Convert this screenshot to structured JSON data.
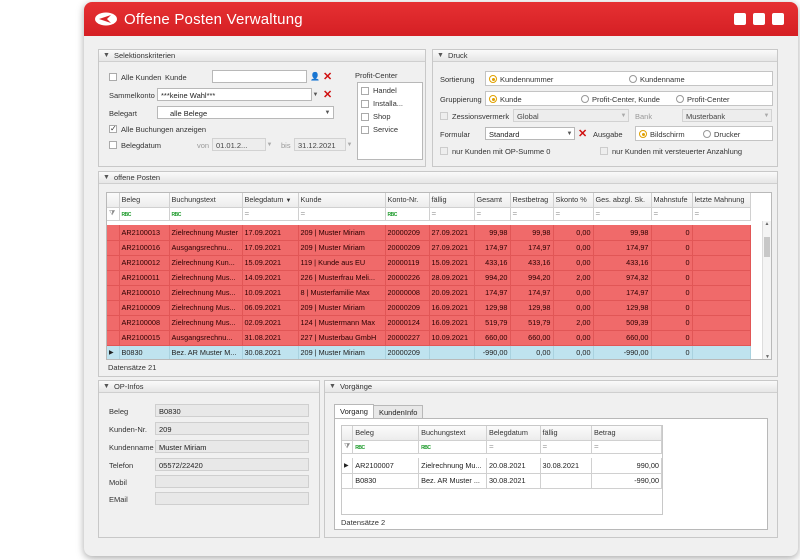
{
  "title": "Offene Posten Verwaltung",
  "selektion": {
    "header": "Selektionskriterien",
    "alle_kunden": "Alle Kunden",
    "kunde_label": "Kunde",
    "kunde_value": "",
    "sammelkonto_label": "Sammelkonto",
    "sammelkonto_value": "***keine Wahl***",
    "belegart_label": "Belegart",
    "belegart_value": "alle Belege",
    "alle_buchungen": "Alle Buchungen anzeigen",
    "belegdatum": "Belegdatum",
    "von": "von",
    "von_value": "01.01.2...",
    "bis": "bis",
    "bis_value": "31.12.2021",
    "profit_center_label": "Profit-Center",
    "profit_centers": [
      "Handel",
      "Installa...",
      "Shop",
      "Service"
    ]
  },
  "druck": {
    "header": "Druck",
    "sortierung": "Sortierung",
    "sort_options": [
      "Kundennummer",
      "Kundenname"
    ],
    "gruppierung": "Gruppierung",
    "group_options": [
      "Kunde",
      "Profit-Center, Kunde",
      "Profit-Center"
    ],
    "zessionsvermerk": "Zessionsvermerk",
    "zession_value": "Global",
    "bank": "Bank",
    "bank_value": "Musterbank",
    "formular": "Formular",
    "formular_value": "Standard",
    "ausgabe": "Ausgabe",
    "ausgabe_options": [
      "Bildschirm",
      "Drucker"
    ],
    "op_summe": "nur Kunden mit OP-Summe 0",
    "versteuert": "nur Kunden mit versteuerter Anzahlung"
  },
  "offene_posten": {
    "header": "offene Posten",
    "columns": [
      "Beleg",
      "Buchungstext",
      "Belegdatum",
      "Kunde",
      "Konto-Nr.",
      "fällig",
      "Gesamt",
      "Restbetrag",
      "Skonto %",
      "Ges. abzgl. Sk.",
      "Mahnstufe",
      "letzte Mahnung"
    ],
    "rows": [
      [
        "AR2100013",
        "Zielrechnung Muster",
        "17.09.2021",
        "209 | Muster Miriam",
        "20000209",
        "27.09.2021",
        "99,98",
        "99,98",
        "0,00",
        "99,98",
        "0",
        ""
      ],
      [
        "AR2100016",
        "Ausgangsrechnu...",
        "17.09.2021",
        "209 | Muster Miriam",
        "20000209",
        "27.09.2021",
        "174,97",
        "174,97",
        "0,00",
        "174,97",
        "0",
        ""
      ],
      [
        "AR2100012",
        "Zielrechnung Kun...",
        "15.09.2021",
        "119 | Kunde aus EU",
        "20000119",
        "15.09.2021",
        "433,16",
        "433,16",
        "0,00",
        "433,16",
        "0",
        ""
      ],
      [
        "AR2100011",
        "Zielrechnung Mus...",
        "14.09.2021",
        "226 | Musterfrau Meli...",
        "20000226",
        "28.09.2021",
        "994,20",
        "994,20",
        "2,00",
        "974,32",
        "0",
        ""
      ],
      [
        "AR2100010",
        "Zielrechnung Mus...",
        "10.09.2021",
        "8 | Musterfamilie Max",
        "20000008",
        "20.09.2021",
        "174,97",
        "174,97",
        "0,00",
        "174,97",
        "0",
        ""
      ],
      [
        "AR2100009",
        "Zielrechnung Mus...",
        "06.09.2021",
        "209 | Muster Miriam",
        "20000209",
        "16.09.2021",
        "129,98",
        "129,98",
        "0,00",
        "129,98",
        "0",
        ""
      ],
      [
        "AR2100008",
        "Zielrechnung Mus...",
        "02.09.2021",
        "124 | Mustermann Max",
        "20000124",
        "16.09.2021",
        "519,79",
        "519,79",
        "2,00",
        "509,39",
        "0",
        ""
      ],
      [
        "AR2100015",
        "Ausgangsrechnu...",
        "31.08.2021",
        "227 | Musterbau GmbH",
        "20000227",
        "10.09.2021",
        "660,00",
        "660,00",
        "0,00",
        "660,00",
        "0",
        ""
      ],
      [
        "B0830",
        "Bez. AR Muster M...",
        "30.08.2021",
        "209 | Muster Miriam",
        "20000209",
        "",
        "-990,00",
        "0,00",
        "0,00",
        "-990,00",
        "0",
        ""
      ]
    ],
    "footer": "Datensätze 21"
  },
  "op_infos": {
    "header": "OP-Infos",
    "fields": [
      {
        "label": "Beleg",
        "value": "B0830"
      },
      {
        "label": "Kunden-Nr.",
        "value": "209"
      },
      {
        "label": "Kundenname",
        "value": "Muster Miriam"
      },
      {
        "label": "Telefon",
        "value": "05572/22420"
      },
      {
        "label": "Mobil",
        "value": ""
      },
      {
        "label": "EMail",
        "value": ""
      }
    ]
  },
  "vorgaenge": {
    "header": "Vorgänge",
    "tabs": [
      "Vorgang",
      "KundenInfo"
    ],
    "columns": [
      "Beleg",
      "Buchungstext",
      "Belegdatum",
      "fällig",
      "Betrag"
    ],
    "rows": [
      [
        "AR2100007",
        "Zielrechnung Mu...",
        "20.08.2021",
        "30.08.2021",
        "990,00"
      ],
      [
        "B0830",
        "Bez. AR Muster ...",
        "30.08.2021",
        "",
        "-990,00"
      ]
    ],
    "footer": "Datensätze 2"
  },
  "colors": {
    "title_red": "#d9252a",
    "overdue_row": "#f06a6a",
    "selected_row": "#bfe3ef",
    "radio_accent": "#e0a000"
  }
}
